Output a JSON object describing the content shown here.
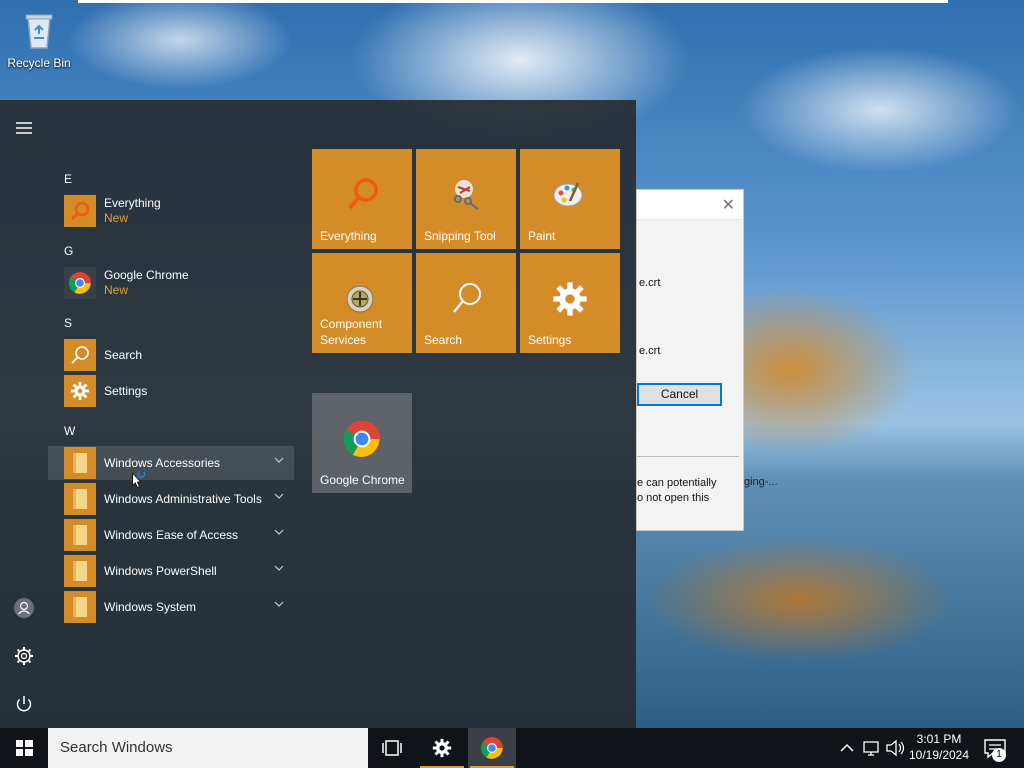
{
  "desktop": {
    "recycle_bin_label": "Recycle Bin"
  },
  "dialog": {
    "line1": "e.crt",
    "line2": "e.crt",
    "cancel_label": "Cancel",
    "warning_line1": "e can potentially",
    "warning_line2": "o not open this",
    "behind_text": "ging-..."
  },
  "start_menu": {
    "groups": [
      {
        "letter": "E",
        "items": [
          {
            "name": "Everything",
            "badge": "New",
            "icon": "search-icon"
          }
        ]
      },
      {
        "letter": "G",
        "items": [
          {
            "name": "Google Chrome",
            "badge": "New",
            "icon": "chrome-icon"
          }
        ]
      },
      {
        "letter": "S",
        "items": [
          {
            "name": "Search",
            "icon": "search-icon"
          },
          {
            "name": "Settings",
            "icon": "gear-icon"
          }
        ]
      },
      {
        "letter": "W",
        "items": [
          {
            "name": "Windows Accessories",
            "icon": "folder-icon"
          },
          {
            "name": "Windows Administrative Tools",
            "icon": "folder-icon"
          },
          {
            "name": "Windows Ease of Access",
            "icon": "folder-icon"
          },
          {
            "name": "Windows PowerShell",
            "icon": "folder-icon"
          },
          {
            "name": "Windows System",
            "icon": "folder-icon"
          }
        ]
      }
    ],
    "tiles": [
      {
        "label": "Everything",
        "icon": "search-icon"
      },
      {
        "label": "Snipping Tool",
        "icon": "scissors-icon"
      },
      {
        "label": "Paint",
        "icon": "palette-icon"
      },
      {
        "label": "Component Services",
        "icon": "component-icon"
      },
      {
        "label": "Search",
        "icon": "search-icon"
      },
      {
        "label": "Settings",
        "icon": "gear-icon"
      },
      {
        "label": "Google Chrome",
        "icon": "chrome-icon"
      }
    ],
    "tile_color": "#d38c28"
  },
  "taskbar": {
    "search_placeholder": "Search Windows",
    "time": "3:01 PM",
    "date": "10/19/2024",
    "notification_count": "1"
  },
  "colors": {
    "accent": "#d38c28",
    "taskbar": "#101418",
    "start_bg": "#262c32"
  }
}
